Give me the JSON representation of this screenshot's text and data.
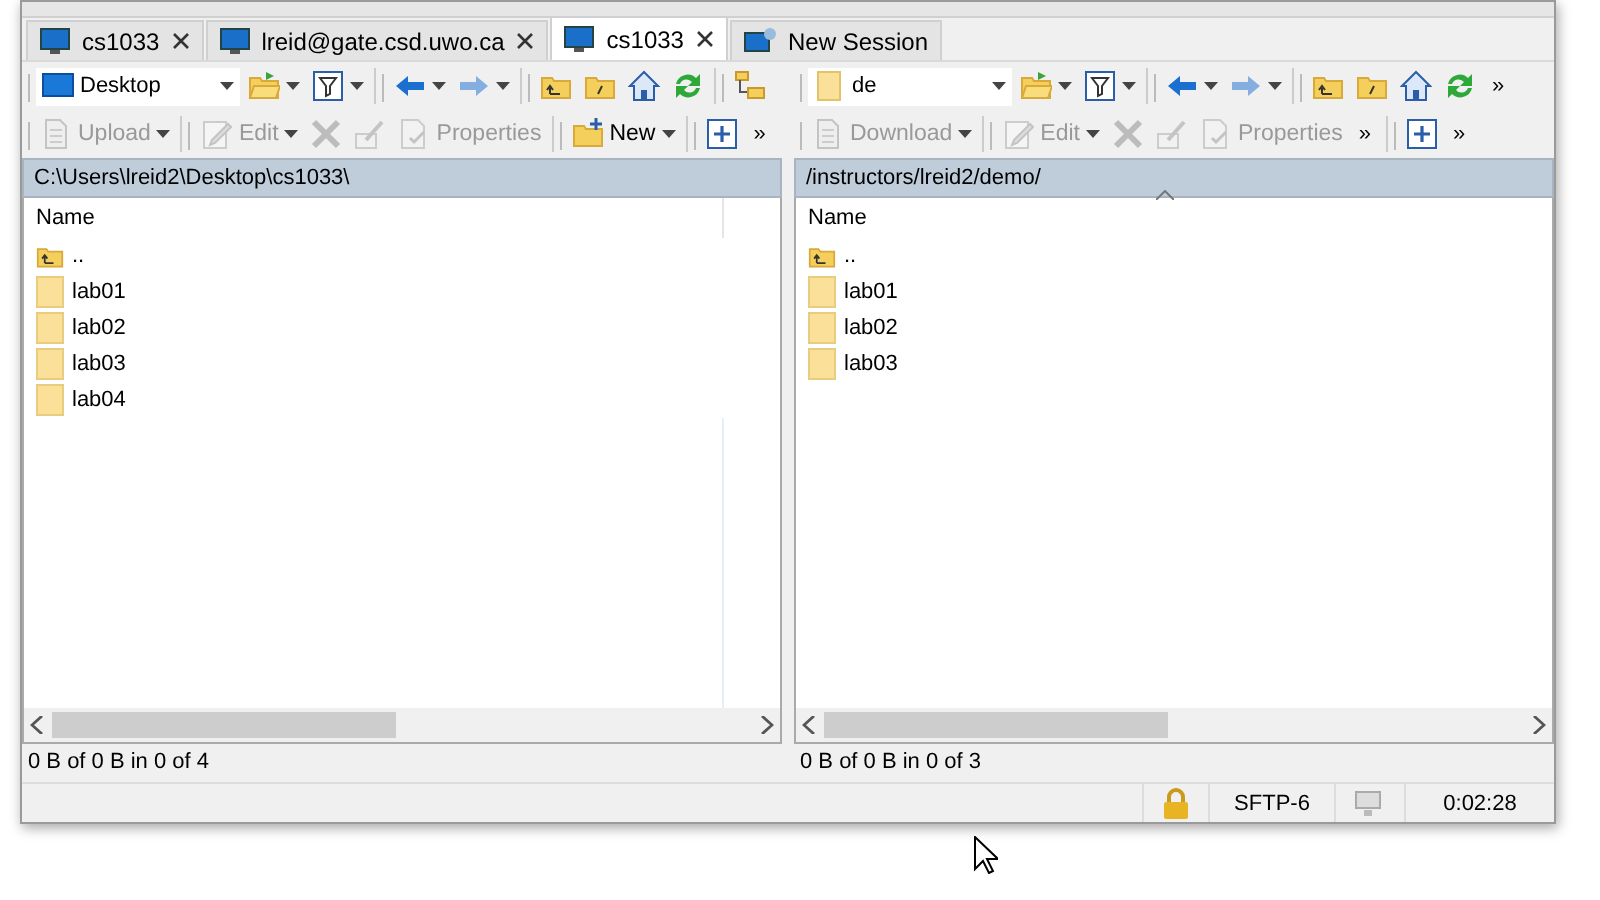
{
  "tabs": [
    {
      "label": "cs1033",
      "kind": "session",
      "selected": false
    },
    {
      "label": "lreid@gate.csd.uwo.ca",
      "kind": "session",
      "selected": false
    },
    {
      "label": "cs1033",
      "kind": "session",
      "selected": true
    },
    {
      "label": "New Session",
      "kind": "new",
      "selected": false
    }
  ],
  "left_panel": {
    "toolbar_1": [
      {
        "items": [
          {
            "kind": "combo",
            "label": "Desktop"
          },
          {
            "kind": "open-folder",
            "dropdown": true,
            "disabled": false
          },
          {
            "kind": "filter",
            "dropdown": true,
            "disabled": false
          }
        ]
      },
      {
        "items": [
          {
            "kind": "back",
            "dropdown": true,
            "disabled": false
          },
          {
            "kind": "forward",
            "dropdown": true,
            "disabled": true
          }
        ]
      },
      {
        "items": [
          {
            "kind": "parent-folder",
            "disabled": false
          },
          {
            "kind": "root-folder",
            "disabled": false
          },
          {
            "kind": "home",
            "disabled": false
          },
          {
            "kind": "refresh",
            "disabled": false
          }
        ]
      },
      {
        "items": [
          {
            "kind": "tree",
            "disabled": false
          }
        ]
      }
    ],
    "toolbar_2": [
      {
        "items": [
          {
            "kind": "upload",
            "label": "Upload",
            "dropdown": true,
            "disabled": true
          }
        ]
      },
      {
        "items": [
          {
            "kind": "edit",
            "label": "Edit",
            "dropdown": true,
            "disabled": true
          },
          {
            "kind": "delete",
            "disabled": true
          },
          {
            "kind": "rename",
            "disabled": true
          },
          {
            "kind": "properties",
            "label": "Properties",
            "disabled": true
          }
        ]
      },
      {
        "items": [
          {
            "kind": "new",
            "label": "New",
            "dropdown": true,
            "disabled": false
          }
        ]
      },
      {
        "items": [
          {
            "kind": "add",
            "disabled": false
          },
          {
            "kind": "more",
            "label": "»"
          }
        ]
      }
    ],
    "path": "C:\\Users\\lreid2\\Desktop\\cs1033\\",
    "column": "Name",
    "sorted": false,
    "second_column": true,
    "files": [
      {
        "name": "..",
        "kind": "parent"
      },
      {
        "name": "lab01",
        "kind": "folder"
      },
      {
        "name": "lab02",
        "kind": "folder"
      },
      {
        "name": "lab03",
        "kind": "folder"
      },
      {
        "name": "lab04",
        "kind": "folder"
      }
    ],
    "status": "0 B of 0 B in 0 of 4"
  },
  "right_panel": {
    "toolbar_1": [
      {
        "items": [
          {
            "kind": "combo",
            "label": "de"
          },
          {
            "kind": "open-folder",
            "dropdown": true,
            "disabled": false
          },
          {
            "kind": "filter",
            "dropdown": true,
            "disabled": false
          }
        ]
      },
      {
        "items": [
          {
            "kind": "back",
            "dropdown": true,
            "disabled": false
          },
          {
            "kind": "forward",
            "dropdown": true,
            "disabled": true
          }
        ]
      },
      {
        "items": [
          {
            "kind": "parent-folder",
            "disabled": false
          },
          {
            "kind": "root-folder",
            "disabled": false
          },
          {
            "kind": "home",
            "disabled": false
          },
          {
            "kind": "refresh",
            "disabled": false
          },
          {
            "kind": "more",
            "label": "»"
          }
        ]
      }
    ],
    "toolbar_2": [
      {
        "items": [
          {
            "kind": "download",
            "label": "Download",
            "dropdown": true,
            "disabled": true
          }
        ]
      },
      {
        "items": [
          {
            "kind": "edit",
            "label": "Edit",
            "dropdown": true,
            "disabled": true
          },
          {
            "kind": "delete",
            "disabled": true
          },
          {
            "kind": "rename",
            "disabled": true
          },
          {
            "kind": "properties",
            "label": "Properties",
            "disabled": true
          },
          {
            "kind": "more",
            "label": "»"
          }
        ]
      },
      {
        "items": [
          {
            "kind": "add",
            "disabled": false
          },
          {
            "kind": "more",
            "label": "»"
          }
        ]
      }
    ],
    "path": "/instructors/lreid2/demo/",
    "column": "Name",
    "sorted": true,
    "second_column": false,
    "files": [
      {
        "name": "..",
        "kind": "parent"
      },
      {
        "name": "lab01",
        "kind": "folder"
      },
      {
        "name": "lab02",
        "kind": "folder"
      },
      {
        "name": "lab03",
        "kind": "folder"
      }
    ],
    "status": "0 B of 0 B in 0 of 3"
  },
  "status_bar": {
    "protocol": "SFTP-6",
    "time": "0:02:28"
  }
}
